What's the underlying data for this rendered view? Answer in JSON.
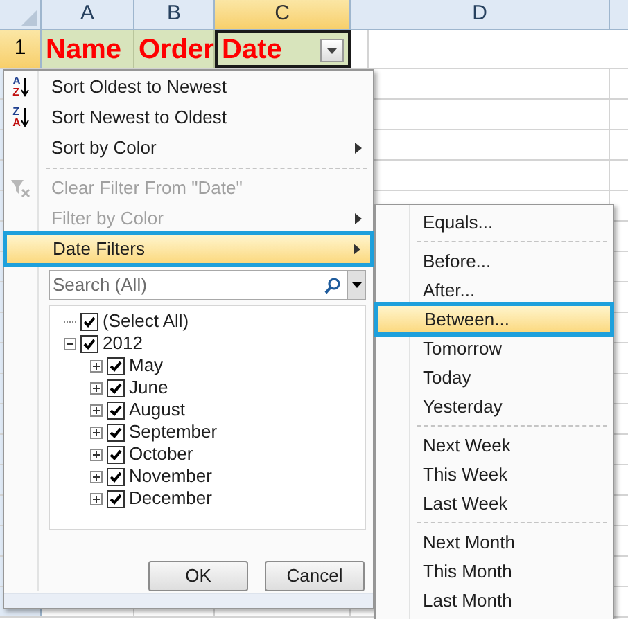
{
  "sheet": {
    "columns": [
      {
        "label": "A",
        "selected": false
      },
      {
        "label": "B",
        "selected": false
      },
      {
        "label": "C",
        "selected": true
      },
      {
        "label": "D",
        "selected": false
      }
    ],
    "row_header": {
      "label": "1",
      "selected": true
    },
    "header_cells": [
      {
        "text": "Name",
        "selected": false,
        "filter_button": false
      },
      {
        "text": "Order",
        "selected": false,
        "filter_button": false
      },
      {
        "text": "Date",
        "selected": true,
        "filter_button": true
      }
    ]
  },
  "filter_menu": {
    "items": [
      {
        "kind": "sort",
        "icon_letters": [
          "A",
          "Z"
        ],
        "label": "Sort Oldest to Newest",
        "disabled": false,
        "selected": false,
        "submenu": false
      },
      {
        "kind": "sort",
        "icon_letters": [
          "Z",
          "A"
        ],
        "label": "Sort Newest to Oldest",
        "disabled": false,
        "selected": false,
        "submenu": false
      },
      {
        "kind": "item",
        "label": "Sort by Color",
        "disabled": false,
        "selected": false,
        "submenu": true
      },
      {
        "kind": "separator"
      },
      {
        "kind": "clear_filter",
        "label": "Clear Filter From \"Date\"",
        "disabled": true,
        "selected": false,
        "submenu": false
      },
      {
        "kind": "item",
        "label": "Filter by Color",
        "disabled": true,
        "selected": false,
        "submenu": true
      },
      {
        "kind": "item",
        "label": "Date Filters",
        "disabled": false,
        "selected": true,
        "submenu": true
      }
    ],
    "search": {
      "placeholder": "Search (All)"
    },
    "tree": [
      {
        "label": "(Select All)",
        "checked": true
      },
      {
        "label": "2012",
        "checked": true,
        "expanded": true,
        "children": [
          {
            "label": "May",
            "checked": true,
            "expanded": false
          },
          {
            "label": "June",
            "checked": true,
            "expanded": false
          },
          {
            "label": "August",
            "checked": true,
            "expanded": false
          },
          {
            "label": "September",
            "checked": true,
            "expanded": false
          },
          {
            "label": "October",
            "checked": true,
            "expanded": false
          },
          {
            "label": "November",
            "checked": true,
            "expanded": false
          },
          {
            "label": "December",
            "checked": true,
            "expanded": false
          }
        ]
      }
    ],
    "buttons": [
      "OK",
      "Cancel"
    ]
  },
  "date_filters_menu": {
    "items": [
      {
        "kind": "item",
        "label": "Equals...",
        "selected": false
      },
      {
        "kind": "separator"
      },
      {
        "kind": "item",
        "label": "Before...",
        "selected": false
      },
      {
        "kind": "item",
        "label": "After...",
        "selected": false
      },
      {
        "kind": "item",
        "label": "Between...",
        "selected": true
      },
      {
        "kind": "item",
        "label": "Tomorrow",
        "selected": false
      },
      {
        "kind": "item",
        "label": "Today",
        "selected": false
      },
      {
        "kind": "item",
        "label": "Yesterday",
        "selected": false
      },
      {
        "kind": "separator"
      },
      {
        "kind": "item",
        "label": "Next Week",
        "selected": false
      },
      {
        "kind": "item",
        "label": "This Week",
        "selected": false
      },
      {
        "kind": "item",
        "label": "Last Week",
        "selected": false
      },
      {
        "kind": "separator"
      },
      {
        "kind": "item",
        "label": "Next Month",
        "selected": false
      },
      {
        "kind": "item",
        "label": "This Month",
        "selected": false
      },
      {
        "kind": "item",
        "label": "Last Month",
        "selected": false
      }
    ]
  }
}
